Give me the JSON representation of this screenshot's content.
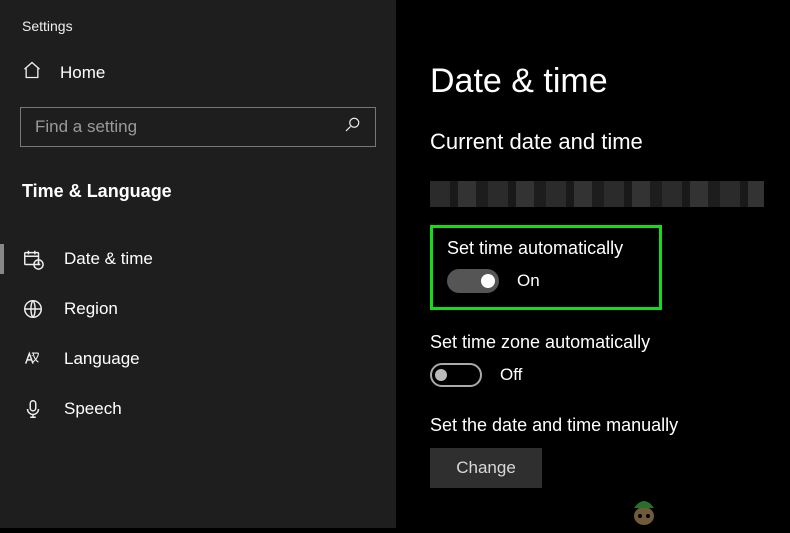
{
  "window": {
    "title": "Settings"
  },
  "sidebar": {
    "home_label": "Home",
    "search_placeholder": "Find a setting",
    "category": "Time & Language",
    "items": [
      {
        "label": "Date & time"
      },
      {
        "label": "Region"
      },
      {
        "label": "Language"
      },
      {
        "label": "Speech"
      }
    ]
  },
  "page": {
    "title": "Date & time",
    "section_current": "Current date and time",
    "set_time_auto": {
      "label": "Set time automatically",
      "state": "On",
      "on": true
    },
    "set_tz_auto": {
      "label": "Set time zone automatically",
      "state": "Off",
      "on": false
    },
    "manual": {
      "label": "Set the date and time manually",
      "button": "Change"
    }
  }
}
